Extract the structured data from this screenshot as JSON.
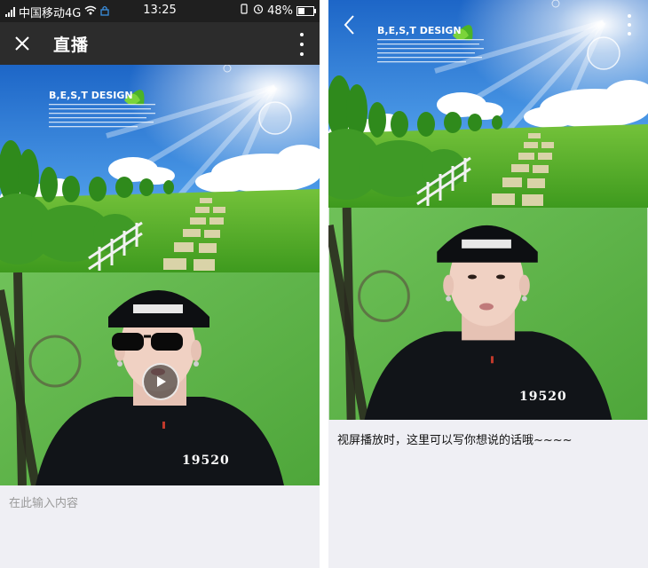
{
  "status_bar": {
    "carrier": "中国移动4G",
    "time": "13:25",
    "battery": "48%",
    "icons": [
      "signal-icon",
      "wifi-icon",
      "lock-icon",
      "vibrate-icon",
      "alarm-icon",
      "battery-icon"
    ]
  },
  "header": {
    "title": "直播",
    "close_icon": "close-icon",
    "more_icon": "more-vertical-icon"
  },
  "banner": {
    "logo_text": "B,E,S,T DESIGN",
    "colors": {
      "sky": "#2f7fd8",
      "grass": "#5fb82f"
    }
  },
  "video": {
    "jersey_number": "19520",
    "play_icon": "play-icon",
    "background_color": "#5fb34a"
  },
  "input": {
    "placeholder": "在此输入内容",
    "value": ""
  },
  "right_screen": {
    "back_icon": "back-chevron-icon",
    "more_icon": "more-vertical-icon",
    "caption": "视屏播放时，这里可以写你想说的话哦~~~~"
  }
}
